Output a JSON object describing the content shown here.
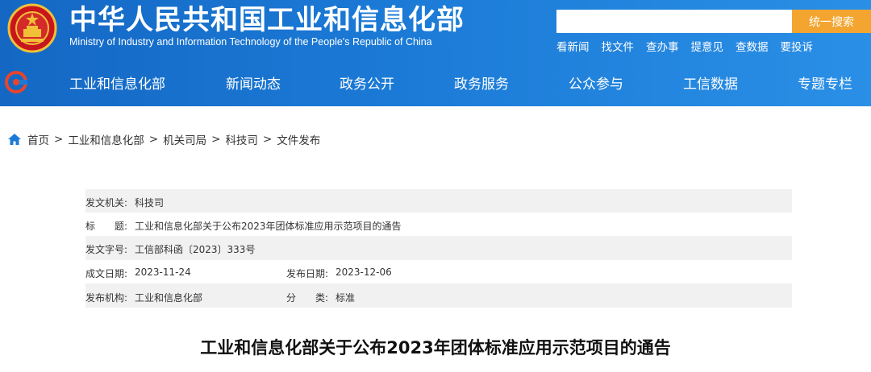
{
  "header": {
    "site_title": "中华人民共和国工业和信息化部",
    "site_subtitle": "Ministry of Industry and Information Technology of the People's Republic of China",
    "search": {
      "placeholder": "",
      "button_label": "统一搜索"
    },
    "quick_links": [
      "看新闻",
      "找文件",
      "查办事",
      "提意见",
      "查数据",
      "要投诉"
    ],
    "colors": {
      "nav_blue": "#1b7ad6",
      "search_orange": "#f3a530"
    }
  },
  "nav": {
    "items": [
      "工业和信息化部",
      "新闻动态",
      "政务公开",
      "政务服务",
      "公众参与",
      "工信数据",
      "专题专栏"
    ]
  },
  "breadcrumb": [
    "首页",
    "工业和信息化部",
    "机关司局",
    "科技司",
    "文件发布"
  ],
  "breadcrumb_sep": ">",
  "meta": {
    "issuer_label": "发文机关:",
    "issuer": "科技司",
    "title_label": "标　　题:",
    "title": "工业和信息化部关于公布2023年团体标准应用示范项目的通告",
    "doc_no_label": "发文字号:",
    "doc_no": "工信部科函〔2023〕333号",
    "created_label": "成文日期:",
    "created": "2023-11-24",
    "published_label": "发布日期:",
    "published": "2023-12-06",
    "org_label": "发布机构:",
    "org": "工业和信息化部",
    "category_label": "分　　类:",
    "category": "标准"
  },
  "doc_title": "工业和信息化部关于公布2023年团体标准应用示范项目的通告"
}
